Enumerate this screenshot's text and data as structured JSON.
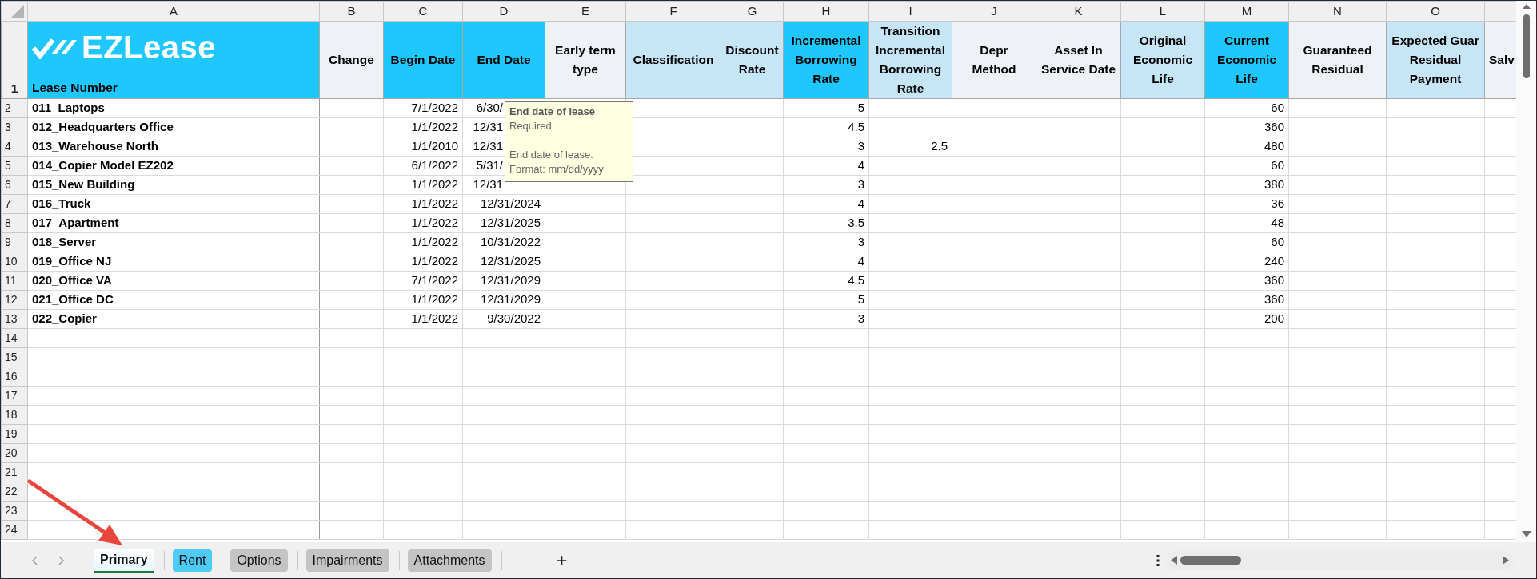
{
  "logo": {
    "text": "EZLease"
  },
  "columns": [
    {
      "letter": "A",
      "header": "Lease Number",
      "color": "#1ec8ff"
    },
    {
      "letter": "B",
      "header": "Change",
      "color": "#eef2f6"
    },
    {
      "letter": "C",
      "header": "Begin Date",
      "color": "#1ec8ff"
    },
    {
      "letter": "D",
      "header": "End Date",
      "color": "#1ec8ff"
    },
    {
      "letter": "E",
      "header": "Early term type",
      "color": "#eef2f6"
    },
    {
      "letter": "F",
      "header": "Classification",
      "color": "#c6e6f7"
    },
    {
      "letter": "G",
      "header": "Discount Rate",
      "color": "#c6e6f7"
    },
    {
      "letter": "H",
      "header": "Incremental Borrowing Rate",
      "color": "#1ec8ff"
    },
    {
      "letter": "I",
      "header": "Transition Incremental Borrowing Rate",
      "color": "#c6e6f7"
    },
    {
      "letter": "J",
      "header": "Depr Method",
      "color": "#eef2f6"
    },
    {
      "letter": "K",
      "header": "Asset In Service Date",
      "color": "#eef2f6"
    },
    {
      "letter": "L",
      "header": "Original Economic Life",
      "color": "#c6e6f7"
    },
    {
      "letter": "M",
      "header": "Current Economic Life",
      "color": "#1ec8ff"
    },
    {
      "letter": "N",
      "header": "Guaranteed Residual",
      "color": "#eef2f6"
    },
    {
      "letter": "O",
      "header": "Expected Guar Residual Payment",
      "color": "#c6e6f7"
    },
    {
      "header": "Salv",
      "color": "#eef2f6"
    }
  ],
  "rows": [
    {
      "number": "2",
      "covered_by_tooltip": true,
      "cells": {
        "A": "011_Laptops",
        "C": "7/1/2022",
        "D": "6/30/",
        "H": "5",
        "M": "60"
      }
    },
    {
      "number": "3",
      "covered_by_tooltip": true,
      "cells": {
        "A": "012_Headquarters Office",
        "C": "1/1/2022",
        "D": "12/31",
        "H": "4.5",
        "M": "360"
      }
    },
    {
      "number": "4",
      "covered_by_tooltip": true,
      "cells": {
        "A": "013_Warehouse North",
        "C": "1/1/2010",
        "D": "12/31",
        "H": "3",
        "I": "2.5",
        "M": "480"
      }
    },
    {
      "number": "5",
      "covered_by_tooltip": true,
      "cells": {
        "A": "014_Copier Model EZ202",
        "C": "6/1/2022",
        "D": "5/31/",
        "H": "4",
        "M": "60"
      }
    },
    {
      "number": "6",
      "covered_by_tooltip": true,
      "cells": {
        "A": "015_New Building",
        "C": "1/1/2022",
        "D": "12/31",
        "H": "3",
        "M": "380"
      }
    },
    {
      "number": "7",
      "covered_by_tooltip": false,
      "cells": {
        "A": "016_Truck",
        "C": "1/1/2022",
        "D": "12/31/2024",
        "H": "4",
        "M": "36"
      }
    },
    {
      "number": "8",
      "covered_by_tooltip": false,
      "cells": {
        "A": "017_Apartment",
        "C": "1/1/2022",
        "D": "12/31/2025",
        "H": "3.5",
        "M": "48"
      }
    },
    {
      "number": "9",
      "covered_by_tooltip": false,
      "cells": {
        "A": "018_Server",
        "C": "1/1/2022",
        "D": "10/31/2022",
        "H": "3",
        "M": "60"
      }
    },
    {
      "number": "10",
      "covered_by_tooltip": false,
      "cells": {
        "A": "019_Office NJ",
        "C": "1/1/2022",
        "D": "12/31/2025",
        "H": "4",
        "M": "240"
      }
    },
    {
      "number": "11",
      "covered_by_tooltip": false,
      "cells": {
        "A": "020_Office VA",
        "C": "7/1/2022",
        "D": "12/31/2029",
        "H": "4.5",
        "M": "360"
      }
    },
    {
      "number": "12",
      "covered_by_tooltip": false,
      "cells": {
        "A": "021_Office DC",
        "C": "1/1/2022",
        "D": "12/31/2029",
        "H": "5",
        "M": "360"
      }
    },
    {
      "number": "13",
      "covered_by_tooltip": false,
      "cells": {
        "A": "022_Copier",
        "C": "1/1/2022",
        "D": "9/30/2022",
        "H": "3",
        "M": "200"
      }
    }
  ],
  "empty_rows": [
    "14",
    "15",
    "16",
    "17",
    "18",
    "19",
    "20",
    "21",
    "22",
    "23",
    "24"
  ],
  "header_row_number": "1",
  "tooltip": {
    "title": "End date of lease",
    "paragraphs": [
      [
        "Required."
      ],
      [
        "End date of lease.",
        "Format: mm/dd/yyyy"
      ]
    ]
  },
  "tabs": [
    {
      "label": "Primary",
      "selected": true,
      "color": "#e6f6fd"
    },
    {
      "label": "Rent",
      "selected": false,
      "color": "#4ecbf6"
    },
    {
      "label": "Options",
      "selected": false,
      "color": "#c4c4c4"
    },
    {
      "label": "Impairments",
      "selected": false,
      "color": "#c4c4c4"
    },
    {
      "label": "Attachments",
      "selected": false,
      "color": "#c4c4c4"
    }
  ],
  "add_sheet": "+"
}
